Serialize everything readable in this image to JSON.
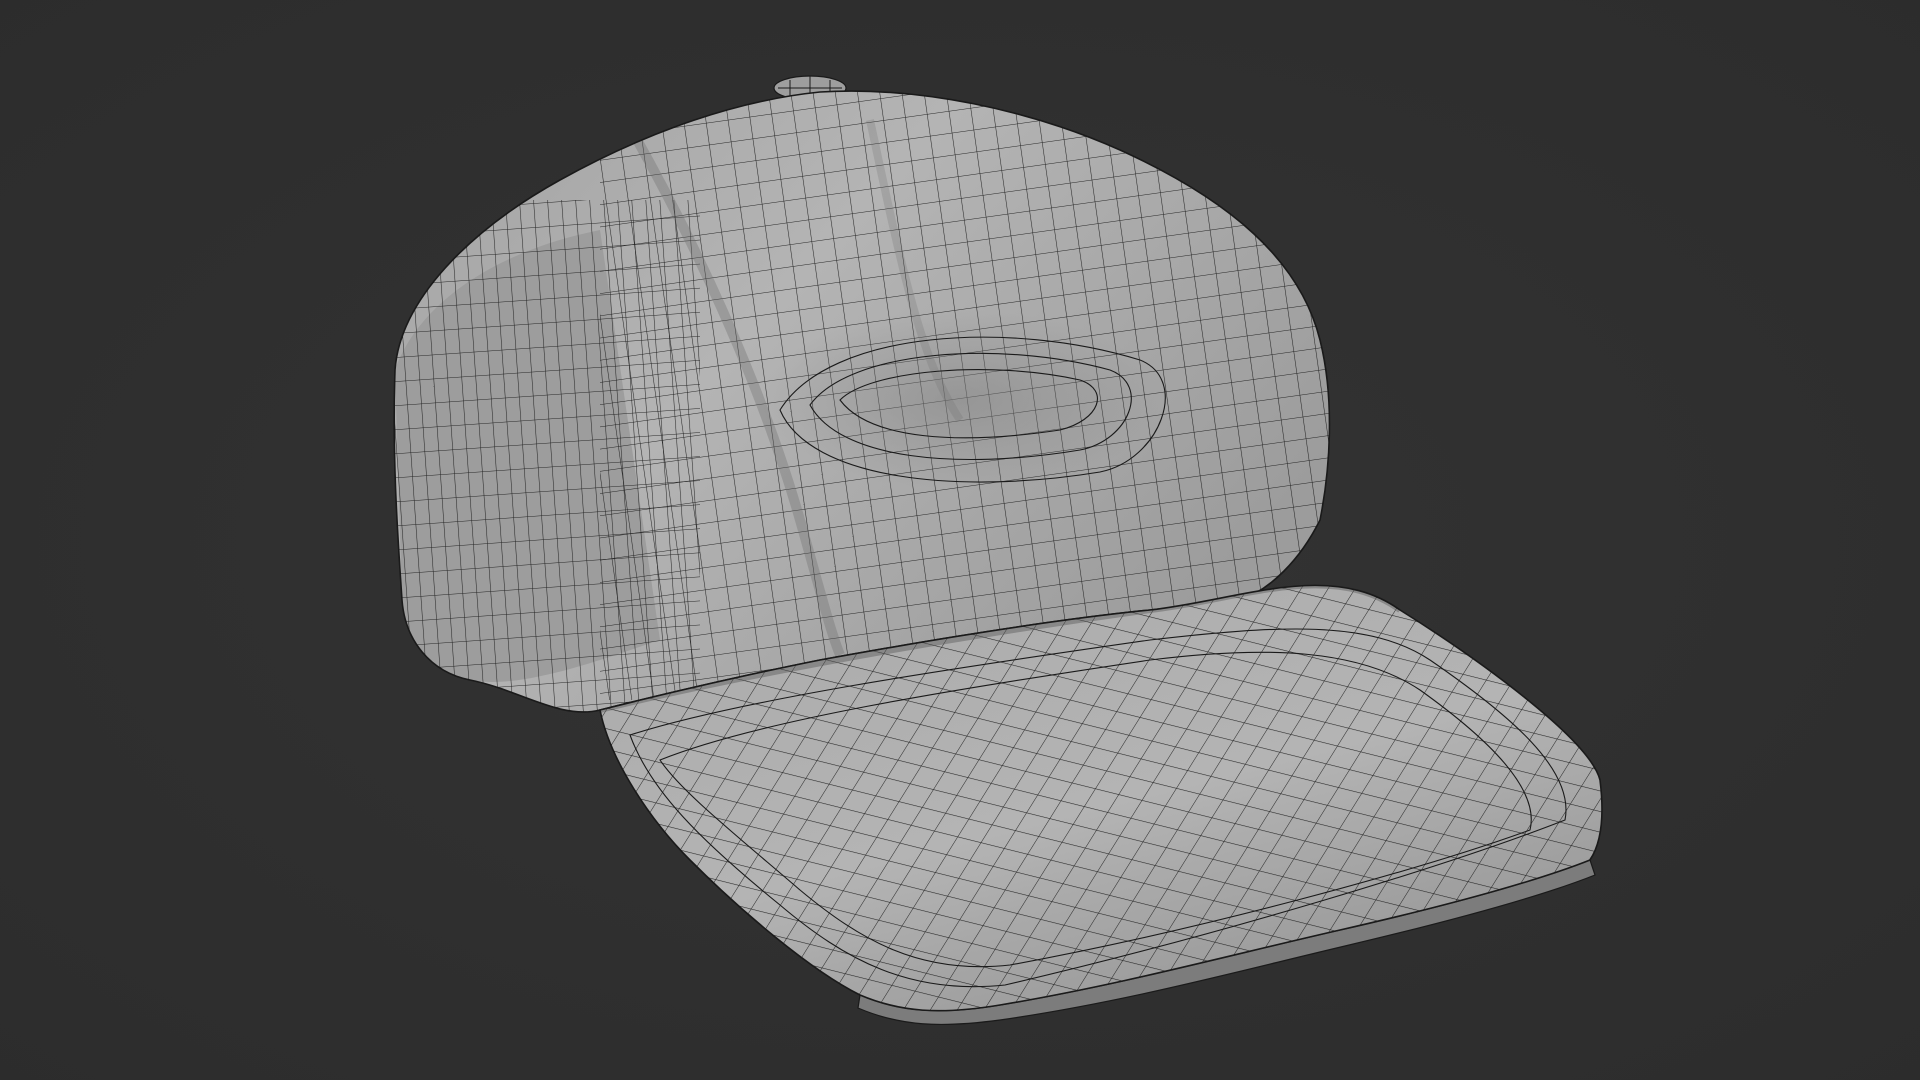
{
  "scene": {
    "subject": "cap-wireframe-mesh",
    "colors": {
      "background": "#333333",
      "background_vignette": "#2c2c2c",
      "mesh_face_light": "#b4b4b4",
      "mesh_face_mid": "#a3a3a3",
      "mesh_face_shadow": "#858585",
      "wire": "#1a1a1a"
    },
    "visible_text": []
  }
}
